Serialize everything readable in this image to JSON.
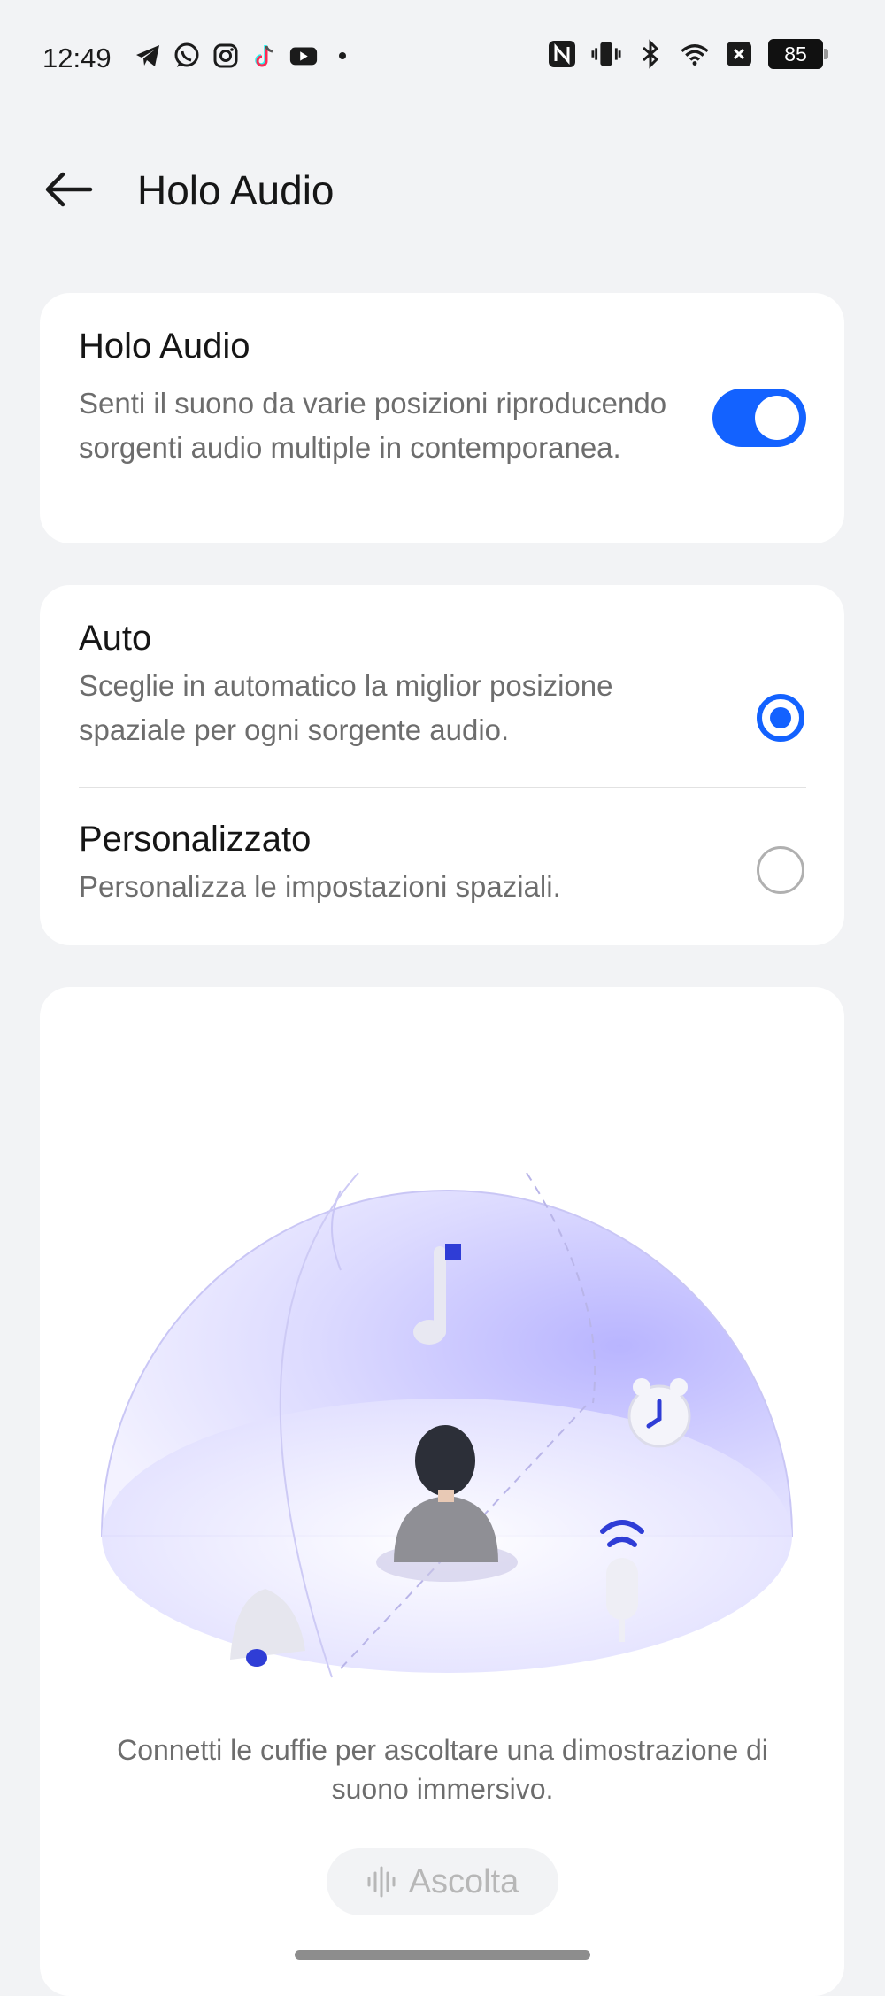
{
  "status_bar": {
    "time": "12:49",
    "battery": "85",
    "left_icons": [
      "telegram-icon",
      "whatsapp-icon",
      "instagram-icon",
      "tiktok-icon",
      "youtube-icon",
      "dot-icon"
    ],
    "right_icons": [
      "nfc-icon",
      "vibrate-icon",
      "bluetooth-icon",
      "wifi-icon",
      "close-box-icon",
      "battery-icon"
    ]
  },
  "header": {
    "title": "Holo Audio"
  },
  "holo_card": {
    "title": "Holo Audio",
    "description": "Senti il suono da varie posizioni riproducendo sorgenti audio multiple in contemporanea.",
    "toggle_on": true
  },
  "mode_card": {
    "options": [
      {
        "title": "Auto",
        "description": "Sceglie in automatico la miglior posizione spaziale per ogni sorgente audio.",
        "selected": true
      },
      {
        "title": "Personalizzato",
        "description": "Personalizza le impostazioni spaziali.",
        "selected": false
      }
    ]
  },
  "demo_card": {
    "description": "Connetti le cuffie per ascoltare una dimostrazione di suono immersivo.",
    "button_label": "Ascolta",
    "accent_color": "#1362ff"
  }
}
